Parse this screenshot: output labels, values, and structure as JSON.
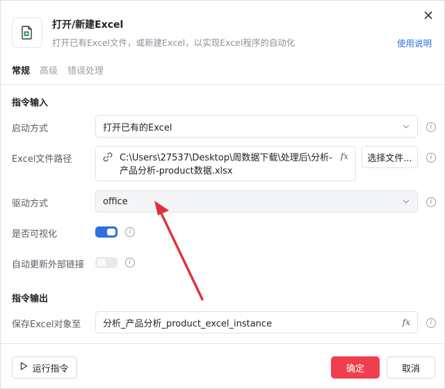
{
  "header": {
    "title": "打开/新建Excel",
    "description": "打开已有Excel文件，或新建Excel，以实现Excel程序的自动化",
    "help_link": "使用说明"
  },
  "tabs": [
    {
      "label": "常规",
      "active": true
    },
    {
      "label": "高级",
      "active": false
    },
    {
      "label": "错误处理",
      "active": false
    }
  ],
  "input_section": {
    "title": "指令输入",
    "launch_mode": {
      "label": "启动方式",
      "value": "打开已有的Excel"
    },
    "file_path": {
      "label": "Excel文件路径",
      "value_line1": "C:\\Users\\27537\\Desktop\\周数据下载\\处理后\\分析-",
      "value_line2": "产品分析-product数据.xlsx",
      "fx": "fx",
      "choose_button": "选择文件..."
    },
    "driver": {
      "label": "驱动方式",
      "value": "office"
    },
    "visible": {
      "label": "是否可视化",
      "on": true
    },
    "auto_update_links": {
      "label": "自动更新外部链接",
      "on": false
    }
  },
  "output_section": {
    "title": "指令输出",
    "save_object": {
      "label": "保存Excel对象至",
      "value": "分析_产品分析_product_excel_instance",
      "fx": "fx"
    }
  },
  "footer": {
    "run_button": "运行指令",
    "ok_button": "确定",
    "cancel_button": "取消"
  },
  "colors": {
    "accent": "#2f6fe0",
    "primary_button": "#ef3e4d",
    "annotation_arrow": "#e0323c",
    "link": "#2a6ddb"
  }
}
